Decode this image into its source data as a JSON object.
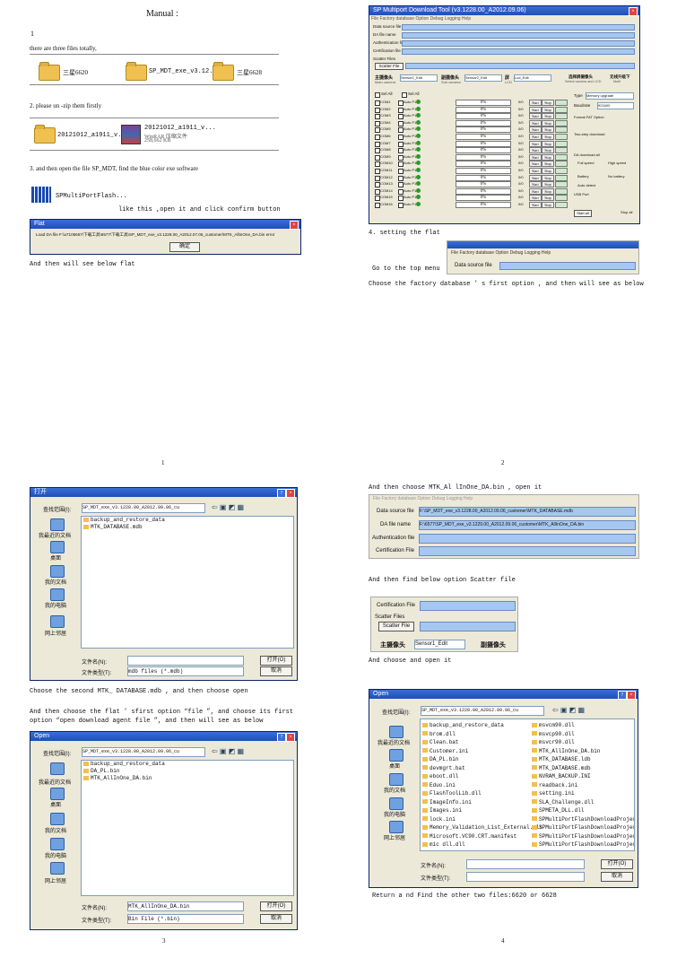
{
  "page1": {
    "title": "Manual :",
    "step1_num": "1",
    "step1_text": "there are three files totally,",
    "files": [
      "三星6620",
      "SP_MDT_exe_v3.12...",
      "三星6628"
    ],
    "step2_text": "2. please un -zip them firstly",
    "zip_folder": "20121012_a1911_v...",
    "zip_file": [
      "20121012_a1911_v...",
      "WinRAR 压缩文件",
      "258,662 KB"
    ],
    "step3_text": "3. and then open the file SP_MDT, find the blue color exe software",
    "exe_name": "SPMultiPortFlash...",
    "like_this": "like this ,open it and click confirm button",
    "dialog_title": "Flat",
    "dialog_text": "Load DA file F:\\a7105657\\下载工具\\6577\\下载工具\\SP_MDT_exe_v3.1228.00_A2012.07.06_customer\\MTK_AllInOne_DA.bin error",
    "dialog_btn": "确定",
    "then_text": "And then will see below flat",
    "page_num": "1"
  },
  "page2": {
    "app_title": "SP Multiport Download Tool (v3.1228.00_A2012.09.06)",
    "top_fields": [
      "Data source file",
      "DA file name",
      "Authentication file",
      "Certification file",
      "Scatter Files"
    ],
    "scatter_btn": "Scatter File",
    "sensor_labels": [
      "主摄像头",
      "副摄像头",
      "屏",
      "选择屏摄像头",
      "无线升级下"
    ],
    "sensor_sub": [
      "Main camera",
      "Sub camera",
      "LCD",
      "Select camera and LCD",
      "Multi"
    ],
    "sensor_vals": [
      "Sensor1_Edit",
      "Sensor2_Edit",
      "Lcd_Edit"
    ],
    "select_all": "Sel All",
    "com_rows": [
      "COM1",
      "COM2",
      "COM3",
      "COM4",
      "COM5",
      "COM6",
      "COM7",
      "COM8",
      "COM9",
      "COM10",
      "COM11",
      "COM12",
      "COM13",
      "COM14",
      "COM15",
      "COM16"
    ],
    "auto_label": "Auto P1",
    "pct": "0%",
    "zero": "0/0",
    "start": "Start",
    "stop": "Stop",
    "right": {
      "type_label": "Type",
      "type_val": "Memory upgrade",
      "baud_label": "Baudrate",
      "baud_val": "921600",
      "format_label": "Format FAT Option",
      "dl_label": "Two-step download",
      "speed_label": "DA download all",
      "full": "Full speed",
      "high": "High speed",
      "battery": "Battery",
      "nobattery": "No battery",
      "auto": "Auto detect",
      "usb": "USB Port",
      "start_all": "Start all",
      "stop_all": "Stop all"
    },
    "step4": "4. setting the flat",
    "go_top": "Go to the top menu",
    "menu": "File  Factory database  Option  Debug Logging  Help",
    "menu_field": "Data source file",
    "choose_text": "Choose the factory database ’ s first option , and then will see as below",
    "page_num": "2"
  },
  "page3": {
    "dlg_title": "打开",
    "look_in": "查找范围(I):",
    "path": "SP_MDT_exe_v3.1228.00_A2012.09.06_cu",
    "items_a": [
      "backup_and_restore_data",
      "MTK_DATABASE.mdb"
    ],
    "sidebar": [
      "我最近的文档",
      "桌面",
      "我的文档",
      "我的电脑",
      "网上邻居"
    ],
    "fname_lbl": "文件名(N):",
    "ftype_lbl": "文件类型(T):",
    "ftype_a": "mdb files (*.mdb)",
    "open_btn": "打开(O)",
    "cancel_btn": "取消",
    "text_a": "Choose the second MTK_ DATABASE.mdb , and then choose open",
    "text_b": "And then choose the flat ’ sfirst option  “file ”, and choose its first option  “open download agent file ”, and then will see as below",
    "dlg2_title": "Open",
    "items_b": [
      "backup_and_restore_data",
      "DA_PL.bin",
      "MTK_AllInOne_DA.bin"
    ],
    "fname_b": "MTK_AllInOne_DA.bin",
    "ftype_b": "Bin File (*.bin)",
    "page_num": "3"
  },
  "page4": {
    "text_a": "And then choose   MTK_Al lInOne_DA.bin  , open it",
    "menu": "File  Factory database  Option  Debug Logging  Help",
    "labels": [
      "Data source file",
      "DA file name",
      "Authentication file",
      "Certification File"
    ],
    "vals": [
      "F:\\SP_MDT_exe_v3.1228.00_A2012.09.06_customer\\MTK_DATABASE.mdb",
      "F:\\6577\\SP_MDT_exe_v3.1229.00_A2012.09.06_customer\\MTK_AllInOne_DA.bin",
      "",
      ""
    ],
    "text_b": "And then find below option Scatter file",
    "cert": "Certification File",
    "scatter_lbl": "Scatter Files",
    "scatter_btn": "Scatter File",
    "cam": "主摄像头",
    "sensor": "Sensor1_Edit",
    "cam2": "副摄像头",
    "text_c": "And choose and open it",
    "dlg_title": "Open",
    "path": "SP_MDT_exe_v3.1228.00_A2012.09.06_cu",
    "col1": [
      "backup_and_restore_data",
      "brom.dll",
      "Clean.bat",
      "Customer.ini",
      "DA_PL.bin",
      "devmgrt.bat",
      "eboot.dll",
      "Eduo.ini",
      "FlashToolLib.dll",
      "ImageInfo.ini",
      "Images.ini",
      "lock.ini",
      "Memory_Validation_List_External.xls",
      "Microsoft.VC90.CRT.manifest",
      "mic dll.dll"
    ],
    "col2": [
      "msvcm90.dll",
      "msvcp90.dll",
      "msvcr90.dll",
      "MTK_AllInOne_DA.bin",
      "MTK_DATABASE.ldb",
      "MTK_DATABASE.mdb",
      "NVRAM_BACKUP.INI",
      "readback.ini",
      "setting.ini",
      "SLA_Challenge.dll",
      "SPMETA_DLL.dll",
      "SPMultiPortFlashDownloadProject...",
      "SPMultiPortFlashDownloadProject...",
      "SPMultiPortFlashDownloadProject...",
      "SPMultiPortFlashDownloadProject..."
    ],
    "text_d": "Return a nd  Find the other two files:6620 or 6628",
    "page_num": "4"
  }
}
